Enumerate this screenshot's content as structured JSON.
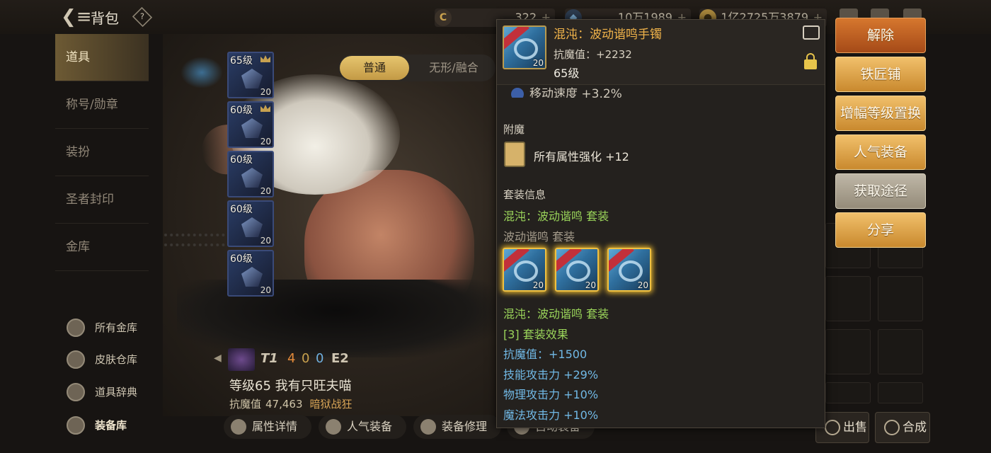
{
  "header": {
    "title": "背包",
    "help_label": "?",
    "currencies": [
      {
        "icon": "c-coin-icon",
        "value": "322"
      },
      {
        "icon": "crystal-icon",
        "value": "10万1989"
      },
      {
        "icon": "gold-coin-icon",
        "value": "1亿2725万3879"
      }
    ],
    "plus": "+"
  },
  "sidebar": {
    "items": [
      {
        "label": "道具",
        "active": true
      },
      {
        "label": "称号/勋章"
      },
      {
        "label": "装扮"
      },
      {
        "label": "圣者封印"
      },
      {
        "label": "金库"
      }
    ],
    "sub_items": [
      {
        "label": "所有金库",
        "icon": "vault-icon"
      },
      {
        "label": "皮肤仓库",
        "icon": "skin-warehouse-icon"
      },
      {
        "label": "道具辞典",
        "icon": "dictionary-icon"
      },
      {
        "label": "装备库",
        "icon": "armor-icon"
      }
    ]
  },
  "tabs": {
    "normal": "普通",
    "fusion": "无形/融合"
  },
  "equipment_slots": [
    {
      "level": "65级",
      "count": "20"
    },
    {
      "level": "60级",
      "count": "20"
    },
    {
      "level": "60级",
      "count": "20"
    },
    {
      "level": "60级",
      "count": "20"
    },
    {
      "level": "60级",
      "count": "20"
    }
  ],
  "character": {
    "badges": {
      "t": "T1",
      "s1": "4",
      "s2": "0",
      "s3": "0",
      "e": "E2"
    },
    "name_line": "等级65 我有只旺夫喵",
    "stat_label": "抗魔值",
    "stat_value": "47,463",
    "class_name": "暗狱战狂"
  },
  "bottom_buttons": [
    {
      "label": "属性详情"
    },
    {
      "label": "人气装备"
    },
    {
      "label": "装备修理"
    },
    {
      "label": "自动装备"
    }
  ],
  "right_buttons": {
    "sell": "出售",
    "combine": "合成"
  },
  "tooltip": {
    "item_name": "混沌：波动谐鸣手镯",
    "stat": "抗魔值：+2232",
    "level": "65级",
    "quantity": "20",
    "clipped_line": "移动速度 +3.2%",
    "enchant_title": "附魔",
    "enchant_text": "所有属性强化 +12",
    "set_title": "套装信息",
    "set_name_1": "混沌：波动谐鸣 套装",
    "set_name_2": "波动谐鸣 套装",
    "set_name_3": "混沌：波动谐鸣 套装",
    "set_effect": "[3] 套装效果",
    "effects": [
      "抗魔值：+1500",
      "技能攻击力 +29%",
      "物理攻击力 +10%",
      "魔法攻击力 +10%"
    ]
  },
  "actions": [
    {
      "label": "解除"
    },
    {
      "label": "铁匠铺"
    },
    {
      "label": "增幅等级置换"
    },
    {
      "label": "人气装备"
    },
    {
      "label": "获取途径"
    },
    {
      "label": "分享"
    }
  ],
  "colors": {
    "gold": "#e6c56e",
    "tooltip_name": "#f0b34a",
    "set_green": "#9ad45a",
    "effect_blue": "#71b9e6",
    "action_orange": "#d6772e"
  }
}
